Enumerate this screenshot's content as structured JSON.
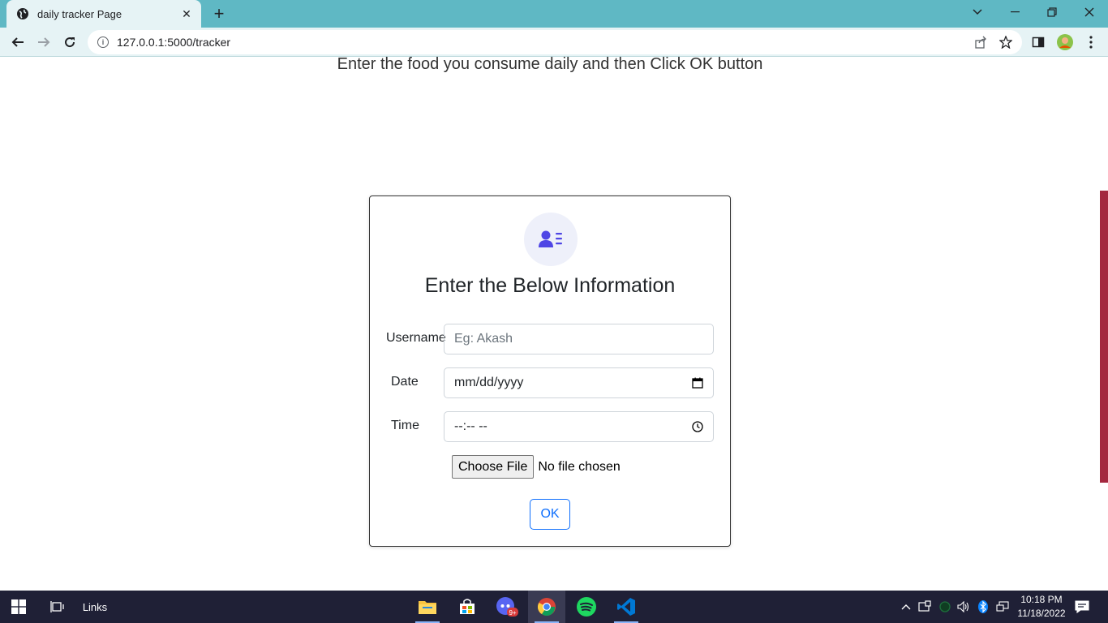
{
  "browser": {
    "tab_title": "daily tracker Page",
    "url": "127.0.0.1:5000/tracker",
    "new_tab_symbol": "+",
    "close_tab_symbol": "✕"
  },
  "page": {
    "instruction": "Enter the food you consume daily and then Click OK button",
    "form": {
      "icon": "user-list-icon",
      "title": "Enter the Below Information",
      "username_label": "Username",
      "username_placeholder": "Eg: Akash",
      "date_label": "Date",
      "date_value": "mm/dd/yyyy",
      "time_label": "Time",
      "time_value": "--:-- --",
      "file_button": "Choose File",
      "file_status": "No file chosen",
      "ok_button": "OK"
    },
    "colors": {
      "accent": "#0d6efd",
      "icon": "#4f46e5",
      "side_accent": "#a4283f",
      "tabbar": "#5fb8c4"
    }
  },
  "taskbar": {
    "links_label": "Links",
    "time": "10:18 PM",
    "date": "11/18/2022",
    "discord_badge": "9+"
  }
}
